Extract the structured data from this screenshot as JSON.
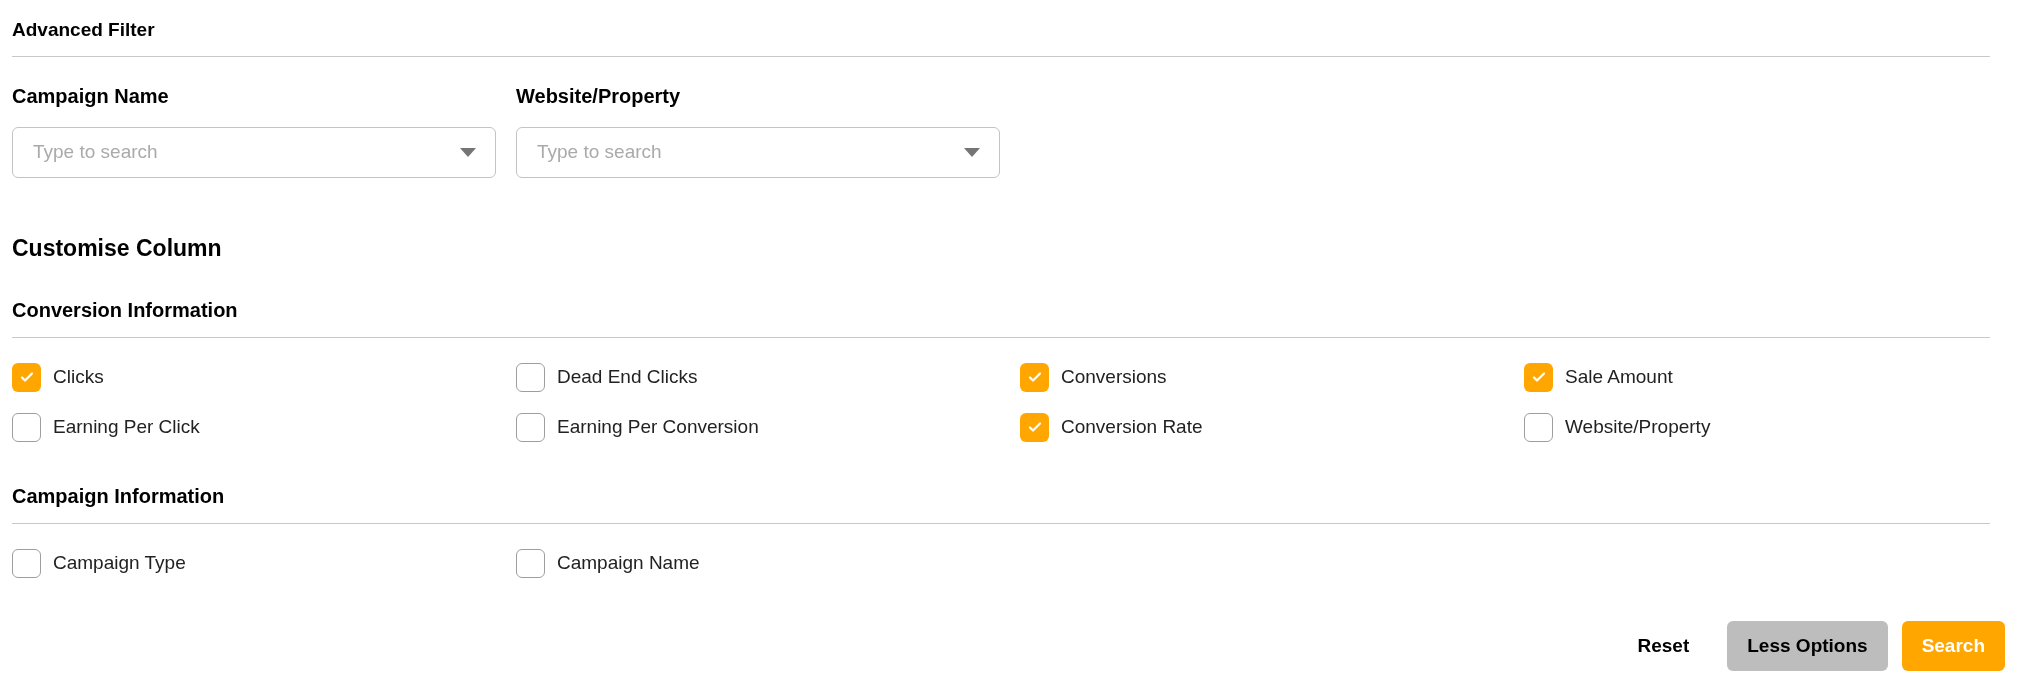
{
  "title": "Advanced Filter",
  "filters": [
    {
      "label": "Campaign Name",
      "placeholder": "Type to search"
    },
    {
      "label": "Website/Property",
      "placeholder": "Type to search"
    }
  ],
  "customise_heading": "Customise Column",
  "groups": [
    {
      "heading": "Conversion Information",
      "options": [
        {
          "label": "Clicks",
          "checked": true
        },
        {
          "label": "Dead End Clicks",
          "checked": false
        },
        {
          "label": "Conversions",
          "checked": true
        },
        {
          "label": "Sale Amount",
          "checked": true
        },
        {
          "label": "Earning Per Click",
          "checked": false
        },
        {
          "label": "Earning Per Conversion",
          "checked": false
        },
        {
          "label": "Conversion Rate",
          "checked": true
        },
        {
          "label": "Website/Property",
          "checked": false
        }
      ]
    },
    {
      "heading": "Campaign Information",
      "options": [
        {
          "label": "Campaign Type",
          "checked": false
        },
        {
          "label": "Campaign Name",
          "checked": false
        }
      ]
    }
  ],
  "buttons": [
    {
      "label": "Reset",
      "kind": "text"
    },
    {
      "label": "Less Options",
      "kind": "secondary"
    },
    {
      "label": "Search",
      "kind": "primary"
    }
  ]
}
